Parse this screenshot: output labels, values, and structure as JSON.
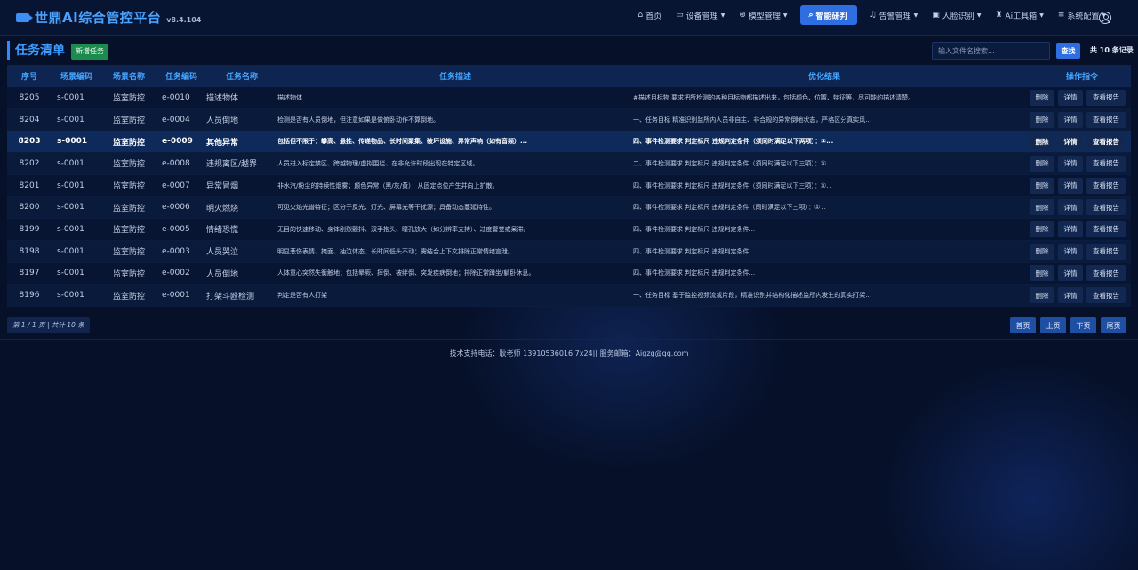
{
  "app": {
    "title": "世鼎AI综合管控平台",
    "version": "v8.4.104"
  },
  "nav": [
    {
      "label": "首页",
      "icon": "home-icon",
      "glyph": "⌂",
      "dropdown": false,
      "active": false
    },
    {
      "label": "设备管理",
      "icon": "camera-icon",
      "glyph": "▭",
      "dropdown": true,
      "active": false
    },
    {
      "label": "模型管理",
      "icon": "cube-icon",
      "glyph": "⊛",
      "dropdown": true,
      "active": false
    },
    {
      "label": "智能研判",
      "icon": "search-icon",
      "glyph": "⌕",
      "dropdown": false,
      "active": true
    },
    {
      "label": "告警管理",
      "icon": "bell-icon",
      "glyph": "♫",
      "dropdown": true,
      "active": false
    },
    {
      "label": "人脸识别",
      "icon": "id-card-icon",
      "glyph": "▣",
      "dropdown": true,
      "active": false
    },
    {
      "label": "Ai工具箱",
      "icon": "robot-icon",
      "glyph": "♜",
      "dropdown": true,
      "active": false
    },
    {
      "label": "系统配置",
      "icon": "sliders-icon",
      "glyph": "≡",
      "dropdown": true,
      "active": false
    }
  ],
  "toolbar": {
    "title": "任务清单",
    "new_label": "新增任务",
    "search_placeholder": "输入文件名搜索...",
    "search_label": "查找",
    "total": "共 10 条记录"
  },
  "table": {
    "columns": [
      "序号",
      "场景编码",
      "场景名称",
      "任务编码",
      "任务名称",
      "任务描述",
      "优化结果",
      "操作指令"
    ],
    "actions": {
      "delete": "删除",
      "detail": "详情",
      "report": "查看报告"
    },
    "rows": [
      {
        "id": "8205",
        "scene_code": "s-0001",
        "scene_name": "监室防控",
        "task_code": "e-0010",
        "task_name": "描述物体",
        "desc": "描述物体",
        "result": "#描述目标物 要求把所检测的各种目标物都描述出来，包括颜色、位置、特征等，尽可能的描述清楚。",
        "selected": false
      },
      {
        "id": "8204",
        "scene_code": "s-0001",
        "scene_name": "监室防控",
        "task_code": "e-0004",
        "task_name": "人员倒地",
        "desc": "检测是否有人员倒地，但注意如果是做俯卧动作不算倒地。",
        "result": "一、任务目标 精准识别监所内人员非自主、非合规的异常倒地状态，严格区分真实风...",
        "selected": false
      },
      {
        "id": "8203",
        "scene_code": "s-0001",
        "scene_name": "监室防控",
        "task_code": "e-0009",
        "task_name": "其他异常",
        "desc": "包括但不限于：攀高、悬挂、传递物品、长时间聚集、破坏设施、异常声响（如有音频）...",
        "result": "四、事件检测要求 判定标尺 违规判定条件（须同时满足以下两项）：①...",
        "selected": true
      },
      {
        "id": "8202",
        "scene_code": "s-0001",
        "scene_name": "监室防控",
        "task_code": "e-0008",
        "task_name": "违规离区/越界",
        "desc": "人员进入标定禁区、跨越物理/虚拟围栏、在非允许时段出现在特定区域。",
        "result": "二、事件检测要求 判定标尺 违规判定条件（须同时满足以下三项）：①...",
        "selected": false
      },
      {
        "id": "8201",
        "scene_code": "s-0001",
        "scene_name": "监室防控",
        "task_code": "e-0007",
        "task_name": "异常冒烟",
        "desc": "非水汽/粉尘的持续性烟雾；颜色异常（黑/灰/黄）；从固定点位产生并向上扩散。",
        "result": "四、事件检测要求 判定标尺 违规判定条件（须同时满足以下三项）：①...",
        "selected": false
      },
      {
        "id": "8200",
        "scene_code": "s-0001",
        "scene_name": "监室防控",
        "task_code": "e-0006",
        "task_name": "明火燃烧",
        "desc": "可见火焰光谱特征；区分于反光、灯光、屏幕光等干扰源；具备动态蔓延特性。",
        "result": "四、事件检测要求 判定标尺 违规判定条件（同时满足以下三项）：①...",
        "selected": false
      },
      {
        "id": "8199",
        "scene_code": "s-0001",
        "scene_name": "监室防控",
        "task_code": "e-0005",
        "task_name": "情绪恐慌",
        "desc": "无目的快速移动、身体剧烈颤抖、双手抱头、瞳孔放大（如分辨率支持）、过度警觉或呆滞。",
        "result": "四、事件检测要求 判定标尺 违规判定条件...",
        "selected": false
      },
      {
        "id": "8198",
        "scene_code": "s-0001",
        "scene_name": "监室防控",
        "task_code": "e-0003",
        "task_name": "人员哭泣",
        "desc": "明显悲伤表情、掩面、抽泣体态、长时间低头不动；需结合上下文排除正常情绪宣泄。",
        "result": "四、事件检测要求 判定标尺 违规判定条件...",
        "selected": false
      },
      {
        "id": "8197",
        "scene_code": "s-0001",
        "scene_name": "监室防控",
        "task_code": "e-0002",
        "task_name": "人员倒地",
        "desc": "人体重心突然失衡触地；包括晕厥、摔倒、被绊倒、突发疾病倒地；排除正常蹲坐/躺卧休息。",
        "result": "四、事件检测要求 判定标尺 违规判定条件...",
        "selected": false
      },
      {
        "id": "8196",
        "scene_code": "s-0001",
        "scene_name": "监室防控",
        "task_code": "e-0001",
        "task_name": "打架斗殴检测",
        "desc": "判定是否有人打架",
        "result": "一、任务目标 基于监控视频流或片段，精准识别并结构化描述监所内发生的真实打架...",
        "selected": false
      }
    ]
  },
  "pagination": {
    "info": "第 1 / 1 页 | 共计 10 条",
    "first": "首页",
    "prev": "上页",
    "next": "下页",
    "last": "尾页"
  },
  "footer": {
    "text": "技术支持电话：耿老师 13910536016 7x24|| 服务邮箱：Aigzg@qq.com"
  },
  "colors": {
    "background": "#061029",
    "accent": "#2f6ee0",
    "title": "#4aa3ff",
    "new_button": "#1e8b4e"
  }
}
